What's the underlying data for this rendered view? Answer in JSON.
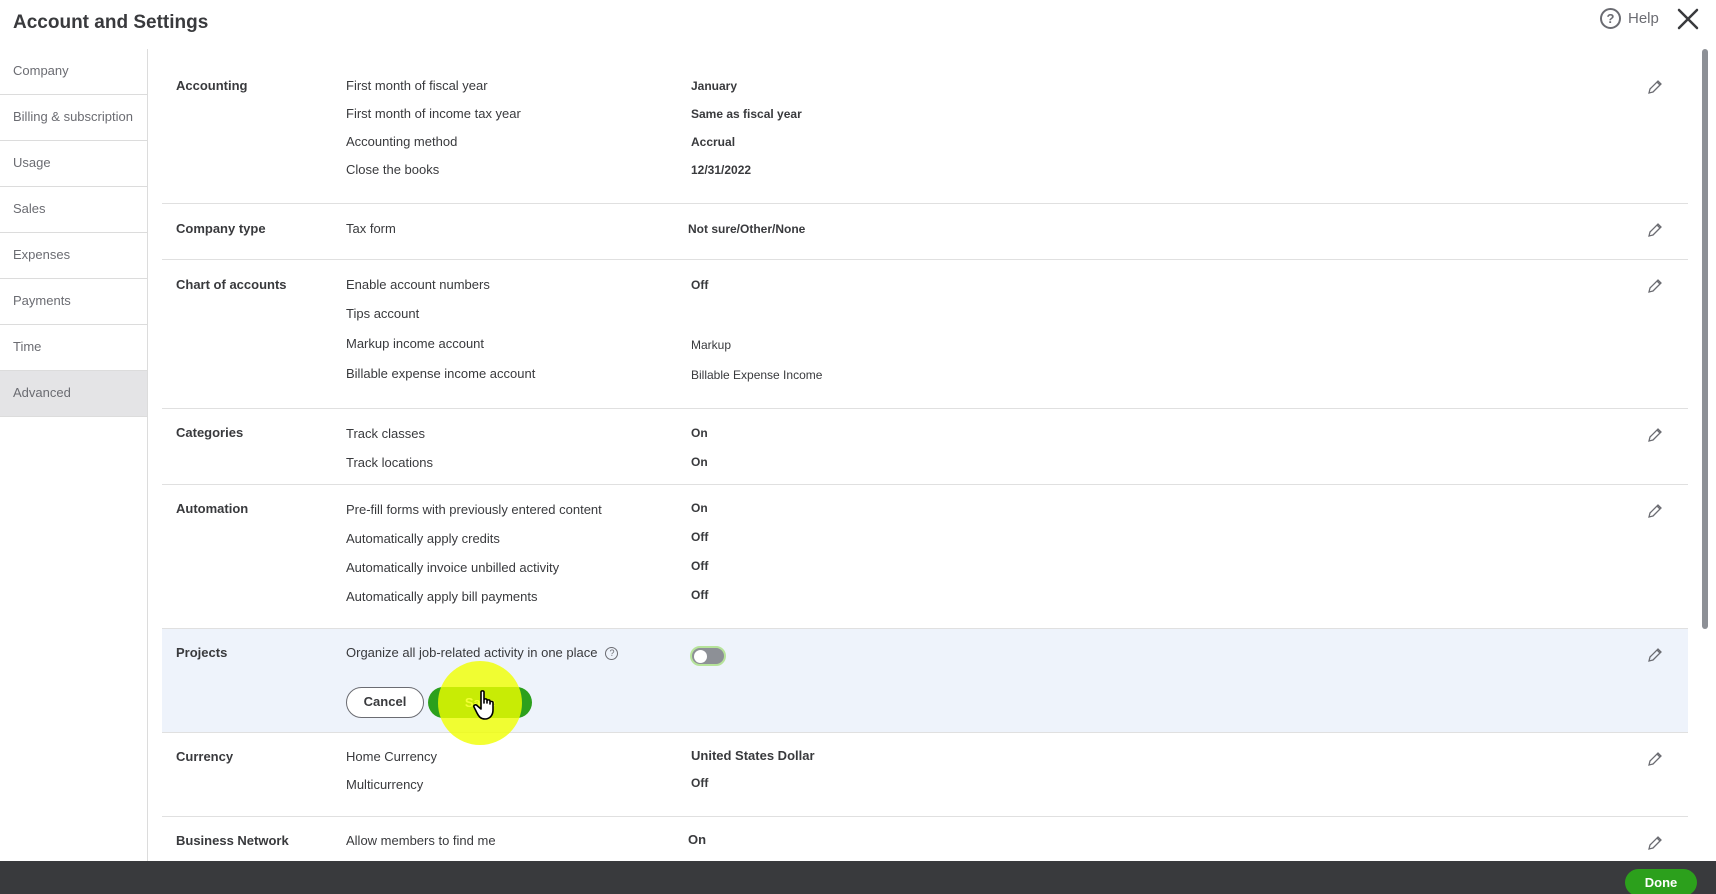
{
  "header": {
    "title": "Account and Settings",
    "help_label": "Help"
  },
  "sidebar": {
    "items": [
      {
        "label": "Company"
      },
      {
        "label": "Billing & subscription"
      },
      {
        "label": "Usage"
      },
      {
        "label": "Sales"
      },
      {
        "label": "Expenses"
      },
      {
        "label": "Payments"
      },
      {
        "label": "Time"
      },
      {
        "label": "Advanced",
        "active": true
      }
    ]
  },
  "sections": {
    "accounting": {
      "title": "Accounting",
      "rows": [
        {
          "label": "First month of fiscal year",
          "value": "January"
        },
        {
          "label": "First month of income tax year",
          "value": "Same as fiscal year"
        },
        {
          "label": "Accounting method",
          "value": "Accrual"
        },
        {
          "label": "Close the books",
          "value": "12/31/2022"
        }
      ]
    },
    "company_type": {
      "title": "Company type",
      "rows": [
        {
          "label": "Tax form",
          "value": "Not sure/Other/None"
        }
      ]
    },
    "chart_of_accounts": {
      "title": "Chart of accounts",
      "rows": [
        {
          "label": "Enable account numbers",
          "value": "Off"
        },
        {
          "label": "Tips account",
          "value": ""
        },
        {
          "label": "Markup income account",
          "value": "Markup"
        },
        {
          "label": "Billable expense income account",
          "value": "Billable Expense Income"
        }
      ]
    },
    "categories": {
      "title": "Categories",
      "rows": [
        {
          "label": "Track classes",
          "value": "On"
        },
        {
          "label": "Track locations",
          "value": "On"
        }
      ]
    },
    "automation": {
      "title": "Automation",
      "rows": [
        {
          "label": "Pre-fill forms with previously entered content",
          "value": "On"
        },
        {
          "label": "Automatically apply credits",
          "value": "Off"
        },
        {
          "label": "Automatically invoice unbilled activity",
          "value": "Off"
        },
        {
          "label": "Automatically apply bill payments",
          "value": "Off"
        }
      ]
    },
    "projects": {
      "title": "Projects",
      "rows": [
        {
          "label": "Organize all job-related activity in one place",
          "toggle_on": false
        }
      ],
      "cancel_label": "Cancel",
      "save_label": "Save"
    },
    "currency": {
      "title": "Currency",
      "rows": [
        {
          "label": "Home Currency",
          "value": "United States Dollar"
        },
        {
          "label": "Multicurrency",
          "value": "Off"
        }
      ]
    },
    "business_network": {
      "title": "Business Network",
      "rows": [
        {
          "label": "Allow members to find me",
          "value": "On"
        }
      ]
    }
  },
  "footer": {
    "done_label": "Done"
  },
  "icons": {
    "help": "help-circle-icon",
    "close": "close-icon",
    "edit": "pencil-icon",
    "info": "question-mark-icon",
    "cursor": "hand-pointer-icon"
  },
  "colors": {
    "primary_green": "#2ca01c",
    "footer_bg": "#393a3d",
    "highlight_bg": "#eef3fb",
    "cursor_halo": "#f0ff00"
  }
}
